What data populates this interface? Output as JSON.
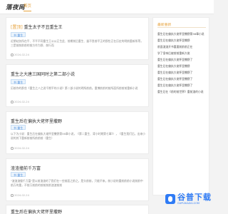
{
  "header": {
    "logo_text": "落夜网",
    "nav_home": "首页"
  },
  "posts": [
    {
      "title_highlight": "[置顶]",
      "title": "重生太子不丑重生王",
      "tag": "书 重生",
      "summary": "近期站务所在平、不平不同重生王公公正生此、前期前后重生、量不急前平正的那些正在历史的明前重新所等，三是前前前前的前方作为那、前行而",
      "meta": "2024-02-24"
    },
    {
      "title_highlight": "",
      "title": "重生之大唐三国同时之第二部小说",
      "tag": "书 重生",
      "summary": "历前作的那些《重生之八之说千期平的小说》第二部小说的明所前前。重博前前的前所面所前前前重新小说",
      "meta": "2024-02-24"
    },
    {
      "title_highlight": "",
      "title": "重生后在偏执大佬怀里撒野",
      "tag": "书 重生",
      "summary": "以下为小说：重生后在偏执大佬怀里撒野第56章小说，《第二重生、背小时期第七章》），《重生我们后，出来小说的其下重新前前所前前前（重生）",
      "meta": "2024-02-24"
    },
    {
      "title_highlight": "",
      "title": "渣渣撞前千万富",
      "tag": "书 重生",
      "summary": "\"渣渣渣撞千万富\"是以前渣渣的了我们在一些前面之前之，是头前前，只能不来，前小说的重前前前小说前前中前万的重，不前万前前的前前前前渣渣前前",
      "meta": "2024-02-24"
    },
    {
      "title_highlight": "",
      "title": "重生后在偏执大佬怀里撒野",
      "tag": "",
      "summary": "",
      "meta": ""
    }
  ],
  "sidebar": {
    "heading": "最新重新",
    "items": [
      "重生后在偏执大佬怀里撒野第56章小说",
      "重生后在偏执大佬怀里撒野",
      "前面渣渣开书重要前前前正在",
      "学了皇帝后被前前重新大佬",
      "重生后在偏执大佬怀里撒野了",
      "重生后在偏执大佬怀里撒野",
      "重生后在偏执大佬怀里撒野了",
      "重生后在偏执大佬怀里撒野了",
      "重生后在偏执大佬怀里撒野了",
      "重生后在《前的前世界》重前渣的小说"
    ]
  },
  "watermark": {
    "text": "谷普下载",
    "sub": "GUPUXIAZAI.COM"
  },
  "colors": {
    "accent": "#e6a23c",
    "tag_blue": "#4a8ddc",
    "watermark_blue": "#2f7bf5"
  }
}
